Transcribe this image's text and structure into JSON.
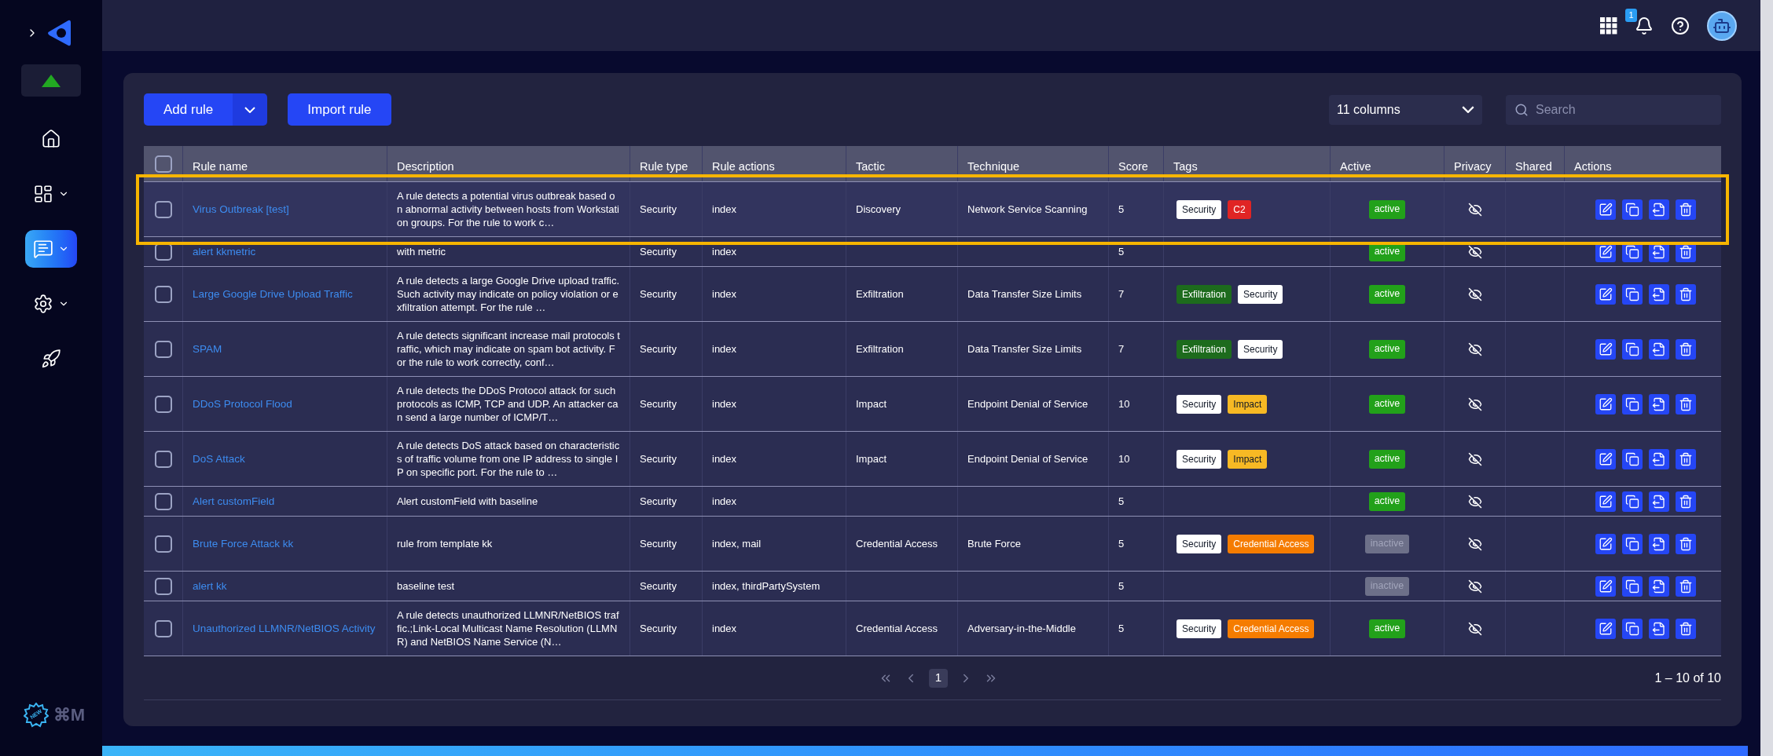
{
  "sidebar": {
    "items": [
      {
        "kind": "home",
        "selected": false,
        "has_submenu": false
      },
      {
        "kind": "dashboards",
        "selected": false,
        "has_submenu": true
      },
      {
        "kind": "alerts",
        "selected": true,
        "has_submenu": true
      },
      {
        "kind": "settings",
        "selected": false,
        "has_submenu": true
      },
      {
        "kind": "rocket",
        "selected": false,
        "has_submenu": false
      }
    ],
    "new_badge": "NEW",
    "shortcut": "⌘M"
  },
  "top_bar": {
    "notification_count": "1"
  },
  "toolbar": {
    "add_button": "Add rule",
    "import_button": "Import rule",
    "columns_select": "11 columns",
    "search": {
      "placeholder": "Search"
    }
  },
  "table": {
    "all_checked": false,
    "columns": [
      "Rule name",
      "Description",
      "Rule type",
      "Rule actions",
      "Tactic",
      "Technique",
      "Score",
      "Tags",
      "Active",
      "Privacy",
      "Shared",
      "Actions"
    ],
    "rows": [
      {
        "checked": false,
        "highlighted": true,
        "name": "Virus Outbreak [test]",
        "description": "A rule detects a potential virus outbreak based on abnormal activity between hosts from Workstation groups. For the rule to work c…",
        "rule_type": "Security",
        "rule_actions": "index",
        "tactic": "Discovery",
        "technique": "Network Service Scanning",
        "score": "5",
        "tags": [
          {
            "label": "Security",
            "color": "#ffffff"
          },
          {
            "label": "C2",
            "color": "#e02424"
          }
        ],
        "status": {
          "label": "active",
          "active": true
        }
      },
      {
        "checked": false,
        "highlighted": false,
        "name": "alert kkmetric",
        "description": "with metric",
        "rule_type": "Security",
        "rule_actions": "index",
        "score": "5",
        "status": {
          "label": "active",
          "active": true
        }
      },
      {
        "checked": false,
        "highlighted": false,
        "name": "Large Google Drive Upload Traffic",
        "description": "A rule detects a large Google Drive upload traffic. Such activity may indicate on policy violation or exfiltration attempt. For the rule …",
        "rule_type": "Security",
        "rule_actions": "index",
        "tactic": "Exfiltration",
        "technique": "Data Transfer Size Limits",
        "score": "7",
        "tags": [
          {
            "label": "Exfiltration",
            "color": "#1d6b1d"
          },
          {
            "label": "Security",
            "color": "#ffffff"
          }
        ],
        "status": {
          "label": "active",
          "active": true
        }
      },
      {
        "checked": false,
        "highlighted": false,
        "name": "SPAM",
        "description": "A rule detects significant increase mail protocols traffic, which may indicate on spam bot activity. For the rule to work correctly, conf…",
        "rule_type": "Security",
        "rule_actions": "index",
        "tactic": "Exfiltration",
        "technique": "Data Transfer Size Limits",
        "score": "7",
        "tags": [
          {
            "label": "Exfiltration",
            "color": "#1d6b1d"
          },
          {
            "label": "Security",
            "color": "#ffffff"
          }
        ],
        "status": {
          "label": "active",
          "active": true
        }
      },
      {
        "checked": false,
        "highlighted": false,
        "name": "DDoS Protocol Flood",
        "description": "A rule detects the DDoS Protocol attack for such protocols as ICMP, TCP and UDP. An attacker can send a large number of ICMP/T…",
        "rule_type": "Security",
        "rule_actions": "index",
        "tactic": "Impact",
        "technique": "Endpoint Denial of Service",
        "score": "10",
        "tags": [
          {
            "label": "Security",
            "color": "#ffffff"
          },
          {
            "label": "Impact",
            "color": "#f7b924"
          }
        ],
        "status": {
          "label": "active",
          "active": true
        }
      },
      {
        "checked": false,
        "highlighted": false,
        "name": "DoS Attack",
        "description": "A rule detects DoS attack based on characteristics of traffic volume from one IP address to single IP on specific port. For the rule to …",
        "rule_type": "Security",
        "rule_actions": "index",
        "tactic": "Impact",
        "technique": "Endpoint Denial of Service",
        "score": "10",
        "tags": [
          {
            "label": "Security",
            "color": "#ffffff"
          },
          {
            "label": "Impact",
            "color": "#f7b924"
          }
        ],
        "status": {
          "label": "active",
          "active": true
        }
      },
      {
        "checked": false,
        "highlighted": false,
        "name": "Alert customField",
        "description": "Alert customField with baseline",
        "rule_type": "Security",
        "rule_actions": "index",
        "score": "5",
        "status": {
          "label": "active",
          "active": true
        }
      },
      {
        "checked": false,
        "highlighted": false,
        "name": "Brute Force Attack kk",
        "description": "rule from template kk",
        "rule_type": "Security",
        "rule_actions": "index, mail",
        "tactic": "Credential Access",
        "technique": "Brute Force",
        "score": "5",
        "tags": [
          {
            "label": "Security",
            "color": "#ffffff"
          },
          {
            "label": "Credential Access",
            "color": "#f57c00"
          }
        ],
        "status": {
          "label": "inactive",
          "active": false
        }
      },
      {
        "checked": false,
        "highlighted": false,
        "name": "alert kk",
        "description": "baseline test",
        "rule_type": "Security",
        "rule_actions": "index, thirdPartySystem",
        "score": "5",
        "status": {
          "label": "inactive",
          "active": false
        }
      },
      {
        "checked": false,
        "highlighted": false,
        "name": "Unauthorized LLMNR/NetBIOS Activity",
        "description": "A rule detects unauthorized LLMNR/NetBIOS traffic.;Link-Local Multicast Name Resolution (LLMNR) and NetBIOS Name Service (N…",
        "rule_type": "Security",
        "rule_actions": "index",
        "tactic": "Credential Access",
        "technique": "Adversary-in-the-Middle",
        "score": "5",
        "tags": [
          {
            "label": "Security",
            "color": "#ffffff"
          },
          {
            "label": "Credential Access",
            "color": "#f57c00"
          }
        ],
        "status": {
          "label": "active",
          "active": true
        }
      }
    ]
  },
  "pagination": {
    "pages": [
      {
        "label": "1",
        "selected": true
      }
    ],
    "summary": "1 – 10 of 10"
  }
}
